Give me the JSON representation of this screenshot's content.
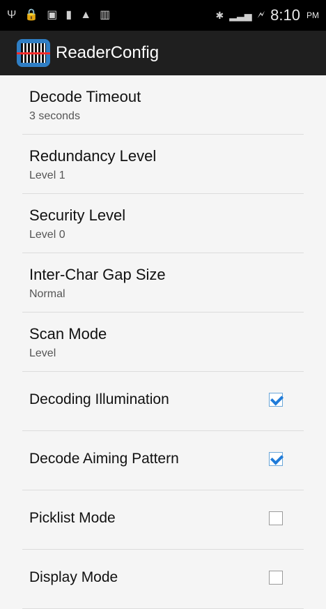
{
  "statusbar": {
    "time": "8:10",
    "ampm": "PM",
    "icons": [
      "usb-icon",
      "lock-icon",
      "sd-card-icon",
      "battery-icon",
      "warning-icon",
      "barcode-icon",
      "bluetooth-icon",
      "signal-icon",
      "battery-charging-icon"
    ]
  },
  "appbar": {
    "title": "ReaderConfig",
    "icon": "barcode-scanner-icon"
  },
  "settings": [
    {
      "title": "Decode Timeout",
      "summary": "3 seconds",
      "type": "list"
    },
    {
      "title": "Redundancy Level",
      "summary": "Level 1",
      "type": "list"
    },
    {
      "title": "Security Level",
      "summary": "Level 0",
      "type": "list"
    },
    {
      "title": "Inter-Char Gap Size",
      "summary": "Normal",
      "type": "list"
    },
    {
      "title": "Scan Mode",
      "summary": "Level",
      "type": "list"
    },
    {
      "title": "Decoding Illumination",
      "checked": true,
      "type": "checkbox"
    },
    {
      "title": "Decode Aiming Pattern",
      "checked": true,
      "type": "checkbox"
    },
    {
      "title": "Picklist Mode",
      "checked": false,
      "type": "checkbox"
    },
    {
      "title": "Display Mode",
      "checked": false,
      "type": "checkbox"
    }
  ],
  "colors": {
    "statusbar_bg": "#000000",
    "appbar_bg": "#1f1f1f",
    "page_bg": "#f5f5f5",
    "checkbox_accent": "#1f7bd9",
    "app_icon_bg": "#2f7ec4"
  }
}
